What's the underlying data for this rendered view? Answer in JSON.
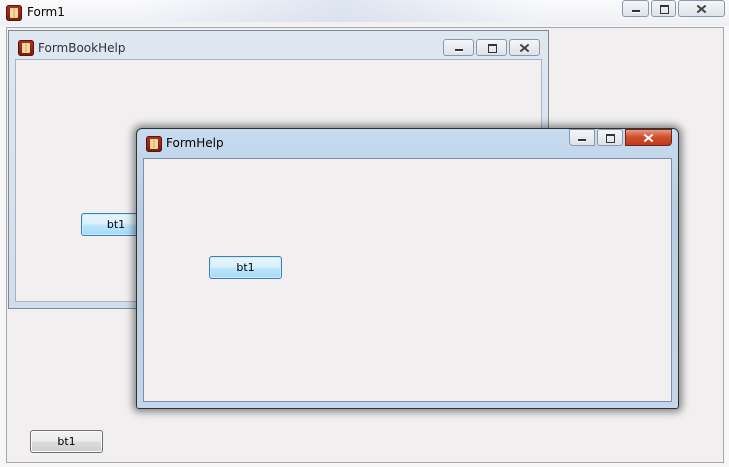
{
  "form1": {
    "title": "Form1",
    "icon": "app-icon",
    "button_label": "bt1"
  },
  "form_book_help": {
    "title": "FormBookHelp",
    "icon": "app-icon",
    "button_label": "bt1"
  },
  "form_help": {
    "title": "FormHelp",
    "icon": "app-icon",
    "button_label": "bt1"
  },
  "colors": {
    "active_frame": "#c4d6ea",
    "inactive_frame": "#d3dde9",
    "client_background": "#f1efef",
    "close_button_active": "#c0391b"
  }
}
